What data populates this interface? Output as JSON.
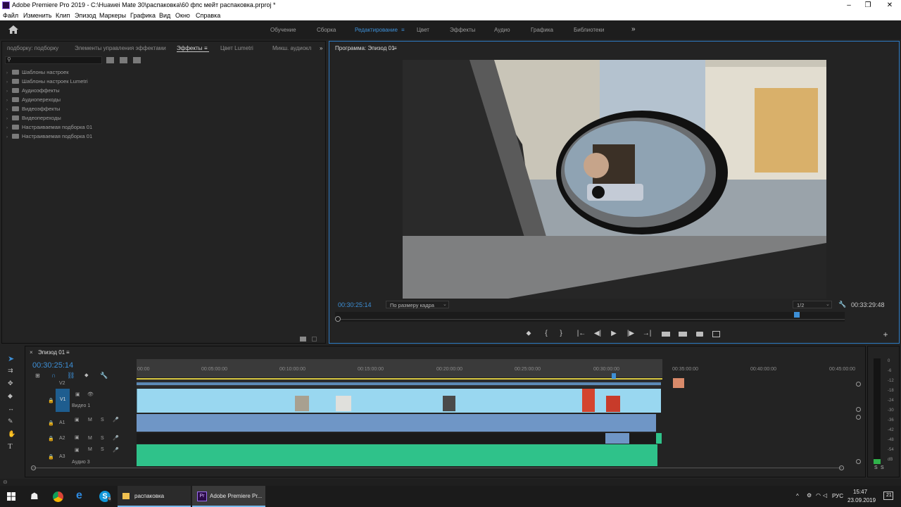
{
  "window": {
    "title": "Adobe Premiere Pro 2019 - C:\\Huawei Mate 30\\распаковка\\60 фпс мейт распаковка.prproj *"
  },
  "menu": [
    "Файл",
    "Изменить",
    "Клип",
    "Эпизод",
    "Маркеры",
    "Графика",
    "Вид",
    "Окно",
    "Справка"
  ],
  "workspaces": {
    "items": [
      "Обучение",
      "Сборка",
      "Редактирование",
      "Цвет",
      "Эффекты",
      "Аудио",
      "Графика",
      "Библиотеки"
    ],
    "active": "Редактирование",
    "more": "»",
    "menu_glyph": "≡"
  },
  "effects_panel": {
    "tabs": [
      "подборку: подборку",
      "Элементы управления эффектами",
      "Эффекты",
      "Цвет Lumetri",
      "Микш. аудиокл"
    ],
    "active_tab": "Эффекты",
    "menu_glyph": "≡",
    "more": "»",
    "tree": [
      "Шаблоны настроек",
      "Шаблоны настроек Lumetri",
      "Аудиоэффекты",
      "Аудиопереходы",
      "Видеоэффекты",
      "Видеопереходы",
      "Настраиваемая подборка 01",
      "Настраиваемая подборка 01"
    ]
  },
  "program_monitor": {
    "title": "Программа: Эпизод 01",
    "menu_glyph": "≡",
    "current_time": "00:30:25:14",
    "fit": "По размеру кадра",
    "resolution": "1/2",
    "duration": "00:33:29:48",
    "controls": {
      "marker": "⬥",
      "mark_in": "{",
      "mark_out": "}",
      "goto_in": "|←",
      "step_back": "◀|",
      "play": "▶",
      "step_fwd": "|▶",
      "goto_out": "→|",
      "add": "+"
    }
  },
  "timeline": {
    "title": "Эпизод 01",
    "menu_glyph": "≡",
    "close_glyph": "×",
    "current_time": "00:30:25:14",
    "ruler": [
      "00:00",
      "00:05:00:00",
      "00:10:00:00",
      "00:15:00:00",
      "00:20:00:00",
      "00:25:00:00",
      "00:30:00:00",
      "00:35:00:00",
      "00:40:00:00",
      "00:45:00:00"
    ],
    "tracks": {
      "v2": "V2",
      "v1": "V1",
      "v1_name": "Видео 1",
      "a1": "A1",
      "a2": "A2",
      "a3": "A3",
      "a3_name": "Аудио 3",
      "m": "M",
      "s": "S"
    }
  },
  "meters": {
    "db": [
      "0",
      "-6",
      "-12",
      "-18",
      "-24",
      "-30",
      "-36",
      "-42",
      "-48",
      "-54",
      "dB"
    ],
    "solo": "S",
    "solo2": "S"
  },
  "taskbar": {
    "apps": [
      "распаковка",
      "Adobe Premiere Pr..."
    ],
    "skype_badge": "6",
    "pr_badge": "Pr",
    "lang": "РУС",
    "time": "15:47",
    "date": "23.09.2019",
    "notif": "21"
  },
  "colors": {
    "accent": "#3d8fd6",
    "video_clip": "#99d7f0",
    "audio_clip": "#6f96c6",
    "green_clip": "#2fc28a"
  }
}
